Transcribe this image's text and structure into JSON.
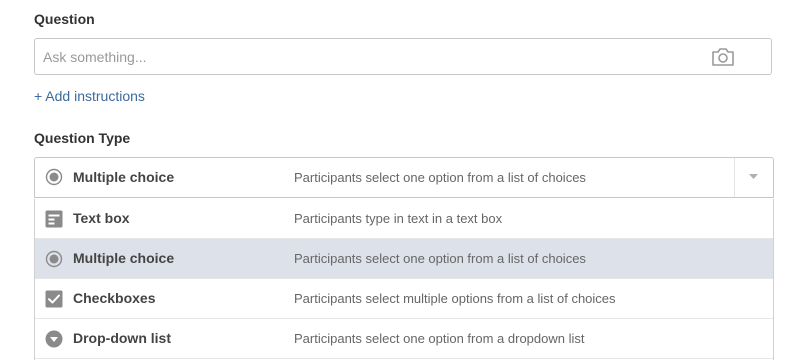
{
  "question": {
    "label": "Question",
    "placeholder": "Ask something...",
    "camera_icon": "camera-icon"
  },
  "add_instructions": "+ Add instructions",
  "question_type": {
    "label": "Question Type",
    "selected": {
      "label": "Multiple choice",
      "description": "Participants select one option from a list of choices",
      "icon": "radio-icon"
    },
    "options": [
      {
        "label": "Text box",
        "description": "Participants type in text in a text box",
        "icon": "text-box-icon",
        "selected": false
      },
      {
        "label": "Multiple choice",
        "description": "Participants select one option from a list of choices",
        "icon": "radio-icon",
        "selected": true
      },
      {
        "label": "Checkboxes",
        "description": "Participants select multiple options from a list of choices",
        "icon": "checkbox-icon",
        "selected": false
      },
      {
        "label": "Drop-down list",
        "description": "Participants select one option from a dropdown list",
        "icon": "dropdown-icon",
        "selected": false
      }
    ]
  },
  "colors": {
    "accent_link": "#3a6a9e",
    "selected_row": "#dde1ea",
    "icon_gray": "#8a8a8a"
  }
}
